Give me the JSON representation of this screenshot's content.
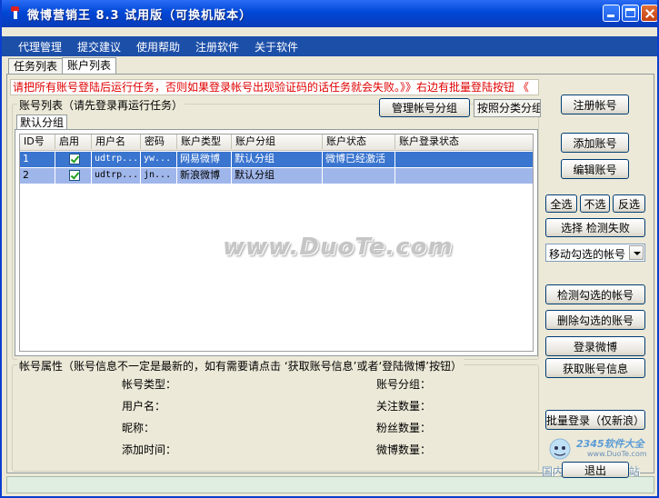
{
  "window": {
    "title": "微博营销王 8.3 试用版（可换机版本）",
    "icon": "app-icon",
    "controls": [
      "minimize-icon",
      "maximize-icon",
      "close-icon"
    ]
  },
  "menu": {
    "items": [
      {
        "label": "代理管理"
      },
      {
        "label": "提交建议"
      },
      {
        "label": "使用帮助"
      },
      {
        "label": "注册软件"
      },
      {
        "label": "关于软件"
      }
    ]
  },
  "tabs": [
    {
      "label": "任务列表",
      "active": false
    },
    {
      "label": "账户列表",
      "active": true
    }
  ],
  "warning": "请把所有账号登陆后运行任务，否则如果登录帐号出现验证码的话任务就会失败。》》右边有批量登陆按钮 《",
  "account_list": {
    "title": "账号列表（请先登录再运行任务）",
    "manage_group_button": "管理帐号分组",
    "group_by_tab": "按照分类分组",
    "group_tab": "默认分组",
    "columns": [
      "ID号",
      "启用",
      "用户名",
      "密码",
      "账户类型",
      "账户分组",
      "账户状态",
      "账户登录状态"
    ],
    "rows": [
      {
        "id": "1",
        "enabled": true,
        "username": "udtrp...",
        "password": "yw...",
        "type": "网易微博",
        "group": "默认分组",
        "status": "微博已经激活",
        "login_status": ""
      },
      {
        "id": "2",
        "enabled": true,
        "username": "udtrp...",
        "password": "jn...",
        "type": "新浪微博",
        "group": "默认分组",
        "status": "",
        "login_status": ""
      }
    ]
  },
  "sidebar": {
    "register_account": "注册帐号",
    "add_account": "添加账号",
    "edit_account": "编辑账号",
    "select_all": "全选",
    "select_none": "不选",
    "invert": "反选",
    "select_failed": "选择 检测失败",
    "move_selected": "移动勾选的帐号",
    "check_selected": "检测勾选的帐号",
    "delete_selected": "删除勾选的账号",
    "login_weibo": "登录微博",
    "get_account_info": "获取账号信息",
    "batch_login": "批量登录（仅新浪）",
    "exit_label": "退出"
  },
  "properties": {
    "title": "帐号属性（账号信息不一定是最新的，如有需要请点击 ‘获取账号信息’或者‘登陆微博’按钮）",
    "account_type": "帐号类型：",
    "account_group": "账号分组：",
    "username": "用户名：",
    "follow_count": "关注数量：",
    "nickname": "昵称：",
    "fans_count": "粉丝数量：",
    "added_time": "添加时间：",
    "weibo_count": "微博数量："
  },
  "watermark": "www.DuoTe.com",
  "corner_logo": {
    "brand": "2345软件大全",
    "url": "www.DuoTe.com",
    "tagline": "国内最安全的软件站"
  },
  "colors": {
    "titlebar": "#0a46d4",
    "menubar": "#1c4fa8",
    "warning_text": "#e00000",
    "row_selected": "#3a75d0",
    "row_selected_alt": "#9fb6ea"
  }
}
